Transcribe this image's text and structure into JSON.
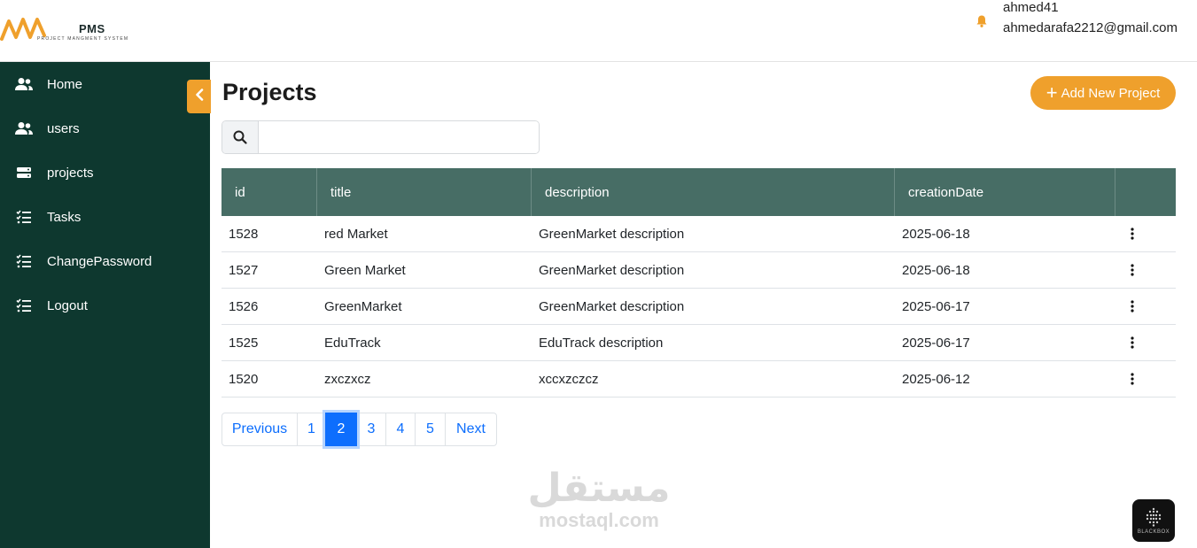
{
  "brand": {
    "title": "PMS",
    "subtitle": "PROJECT MANGMENT SYSTEM",
    "accent_color": "#efa02c",
    "sidebar_color": "#0e382f",
    "table_header_color": "#476d65"
  },
  "header": {
    "user_name": "ahmed41",
    "user_email": "ahmedarafa2212@gmail.com",
    "notification_icon": "bell-icon"
  },
  "sidebar": {
    "items": [
      {
        "label": "Home",
        "icon": "users-icon"
      },
      {
        "label": "users",
        "icon": "users-icon"
      },
      {
        "label": "projects",
        "icon": "server-icon"
      },
      {
        "label": "Tasks",
        "icon": "list-check-icon"
      },
      {
        "label": "ChangePassword",
        "icon": "list-check-icon"
      },
      {
        "label": "Logout",
        "icon": "list-check-icon"
      }
    ],
    "collapse_icon": "chevron-left-icon"
  },
  "main": {
    "title": "Projects",
    "add_button_label": "Add New Project",
    "search": {
      "placeholder": "",
      "value": ""
    },
    "table": {
      "columns": [
        "id",
        "title",
        "description",
        "creationDate",
        ""
      ],
      "rows": [
        {
          "id": "1528",
          "title": "red Market",
          "description": "GreenMarket description",
          "creationDate": "2025-06-18"
        },
        {
          "id": "1527",
          "title": "Green Market",
          "description": "GreenMarket description",
          "creationDate": "2025-06-18"
        },
        {
          "id": "1526",
          "title": "GreenMarket",
          "description": "GreenMarket description",
          "creationDate": "2025-06-17"
        },
        {
          "id": "1525",
          "title": "EduTrack",
          "description": "EduTrack description",
          "creationDate": "2025-06-17"
        },
        {
          "id": "1520",
          "title": "zxczxcz",
          "description": "xccxzczcz",
          "creationDate": "2025-06-12"
        }
      ]
    },
    "pagination": {
      "previous": "Previous",
      "pages": [
        "1",
        "2",
        "3",
        "4",
        "5"
      ],
      "current": "2",
      "next": "Next"
    }
  },
  "watermark": {
    "arabic": "مستقل",
    "english": "mostaql.com"
  },
  "badge": {
    "label": "BLACKBOX"
  }
}
